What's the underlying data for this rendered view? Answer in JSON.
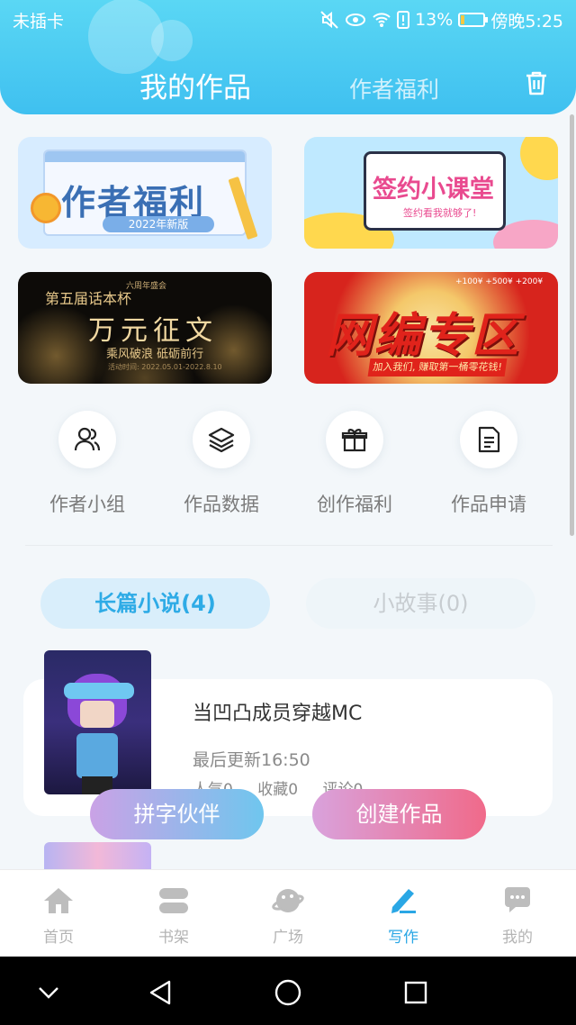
{
  "status_bar": {
    "carrier": "未插卡",
    "battery": "13%",
    "time": "傍晚5:25",
    "battery_level": 0.13
  },
  "header": {
    "active_tab": "我的作品",
    "other_tab": "作者福利",
    "trash_icon": "trash-icon"
  },
  "banners": [
    {
      "title": "作者福利",
      "subtitle": "2022年新版"
    },
    {
      "title": "签约小课堂",
      "subtitle": "签约看我就够了!"
    },
    {
      "tag": "六周年盛会",
      "title_small": "第五届话本杯",
      "title": "万元征文",
      "subtitle": "乘风破浪 砥砺前行",
      "dates": "活动时间: 2022.05.01-2022.8.10"
    },
    {
      "title": "网编专区",
      "subtitle": "加入我们, 赚取第一桶零花钱!",
      "money": "+100¥  +500¥  +200¥"
    }
  ],
  "features": [
    {
      "label": "作者小组",
      "icon": "users-icon"
    },
    {
      "label": "作品数据",
      "icon": "layers-icon"
    },
    {
      "label": "创作福利",
      "icon": "gift-icon"
    },
    {
      "label": "作品申请",
      "icon": "document-icon"
    }
  ],
  "segments": {
    "long": "长篇小说(4)",
    "short": "小故事(0)"
  },
  "work": {
    "title": "当凹凸成员穿越MC",
    "updated": "最后更新16:50",
    "popularity": "人气0",
    "favorites": "收藏0",
    "comments": "评论0"
  },
  "fabs": {
    "partner": "拼字伙伴",
    "create": "创建作品"
  },
  "bottom_nav": [
    {
      "label": "首页",
      "icon": "home-icon"
    },
    {
      "label": "书架",
      "icon": "bookshelf-icon"
    },
    {
      "label": "广场",
      "icon": "planet-icon"
    },
    {
      "label": "写作",
      "icon": "pen-icon",
      "active": true
    },
    {
      "label": "我的",
      "icon": "chat-bubble-icon"
    }
  ],
  "colors": {
    "accent": "#2aa7e5",
    "header": "#4fcbf3",
    "pink": "#f06a8a"
  }
}
